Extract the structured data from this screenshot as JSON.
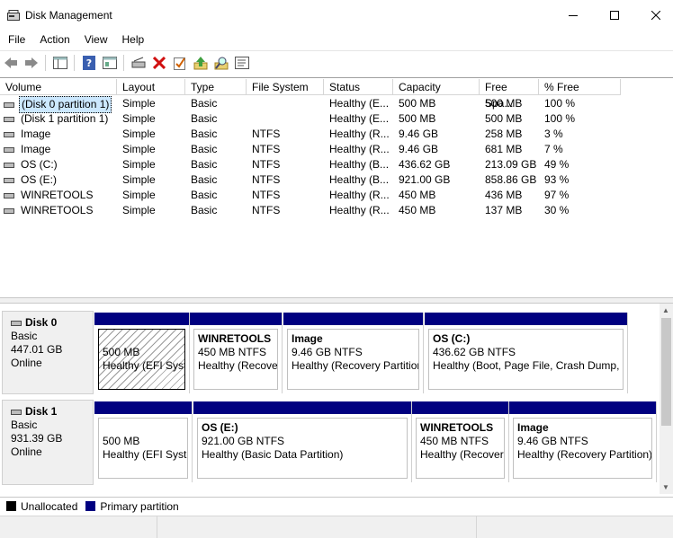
{
  "window": {
    "title": "Disk Management"
  },
  "menu": [
    "File",
    "Action",
    "View",
    "Help"
  ],
  "toolbar": [
    "back-icon",
    "forward-icon",
    "console-tree-icon",
    "help-icon",
    "properties-icon",
    "connect-disk-icon",
    "delete-icon",
    "check-icon",
    "up-icon",
    "search-icon",
    "settings-icon"
  ],
  "columns": [
    "Volume",
    "Layout",
    "Type",
    "File System",
    "Status",
    "Capacity",
    "Free Spa...",
    "% Free"
  ],
  "volumes": [
    {
      "volume": "(Disk 0 partition 1)",
      "layout": "Simple",
      "type": "Basic",
      "fs": "",
      "status": "Healthy (E...",
      "capacity": "500 MB",
      "free": "500 MB",
      "pct": "100 %"
    },
    {
      "volume": "(Disk 1 partition 1)",
      "layout": "Simple",
      "type": "Basic",
      "fs": "",
      "status": "Healthy (E...",
      "capacity": "500 MB",
      "free": "500 MB",
      "pct": "100 %"
    },
    {
      "volume": "Image",
      "layout": "Simple",
      "type": "Basic",
      "fs": "NTFS",
      "status": "Healthy (R...",
      "capacity": "9.46 GB",
      "free": "258 MB",
      "pct": "3 %"
    },
    {
      "volume": "Image",
      "layout": "Simple",
      "type": "Basic",
      "fs": "NTFS",
      "status": "Healthy (R...",
      "capacity": "9.46 GB",
      "free": "681 MB",
      "pct": "7 %"
    },
    {
      "volume": "OS (C:)",
      "layout": "Simple",
      "type": "Basic",
      "fs": "NTFS",
      "status": "Healthy (B...",
      "capacity": "436.62 GB",
      "free": "213.09 GB",
      "pct": "49 %"
    },
    {
      "volume": "OS (E:)",
      "layout": "Simple",
      "type": "Basic",
      "fs": "NTFS",
      "status": "Healthy (B...",
      "capacity": "921.00 GB",
      "free": "858.86 GB",
      "pct": "93 %"
    },
    {
      "volume": "WINRETOOLS",
      "layout": "Simple",
      "type": "Basic",
      "fs": "NTFS",
      "status": "Healthy (R...",
      "capacity": "450 MB",
      "free": "436 MB",
      "pct": "97 %"
    },
    {
      "volume": "WINRETOOLS",
      "layout": "Simple",
      "type": "Basic",
      "fs": "NTFS",
      "status": "Healthy (R...",
      "capacity": "450 MB",
      "free": "137 MB",
      "pct": "30 %"
    }
  ],
  "disks": [
    {
      "name": "Disk 0",
      "type": "Basic",
      "size": "447.01 GB",
      "state": "Online",
      "partitions": [
        {
          "name": "",
          "size": "500 MB",
          "status": "Healthy (EFI Syste"
        },
        {
          "name": "WINRETOOLS",
          "size": "450 MB NTFS",
          "status": "Healthy (Recover"
        },
        {
          "name": "Image",
          "size": "9.46 GB NTFS",
          "status": "Healthy (Recovery Partition"
        },
        {
          "name": "OS  (C:)",
          "size": "436.62 GB NTFS",
          "status": "Healthy (Boot, Page File, Crash Dump, E"
        }
      ]
    },
    {
      "name": "Disk 1",
      "type": "Basic",
      "size": "931.39 GB",
      "state": "Online",
      "partitions": [
        {
          "name": "",
          "size": "500 MB",
          "status": "Healthy (EFI Syste"
        },
        {
          "name": "OS  (E:)",
          "size": "921.00 GB NTFS",
          "status": "Healthy (Basic Data Partition)"
        },
        {
          "name": "WINRETOOLS",
          "size": "450 MB NTFS",
          "status": "Healthy (Recover"
        },
        {
          "name": "Image",
          "size": "9.46 GB NTFS",
          "status": "Healthy (Recovery Partition)"
        }
      ]
    }
  ],
  "legend": [
    {
      "label": "Unallocated",
      "color": "#000000"
    },
    {
      "label": "Primary partition",
      "color": "#000080"
    }
  ]
}
